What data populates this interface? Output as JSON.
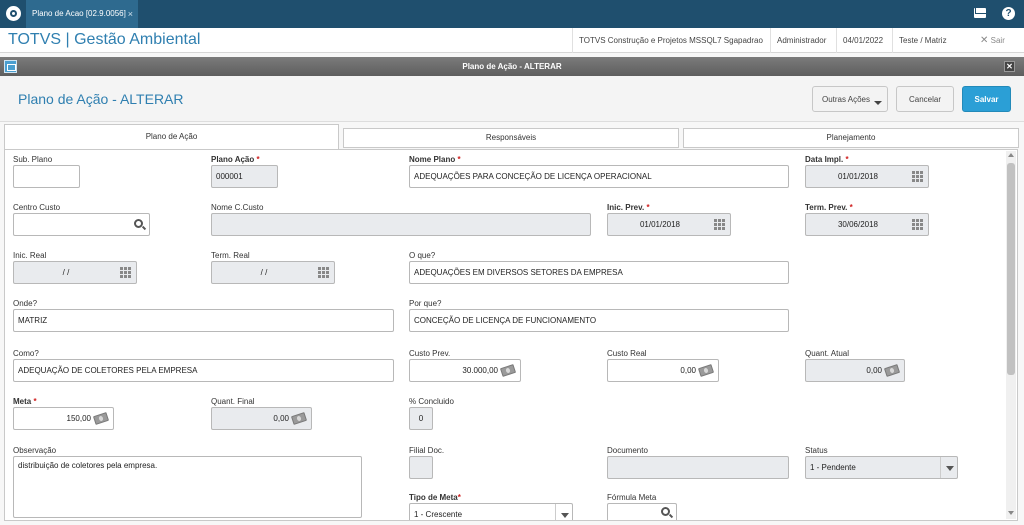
{
  "top": {
    "tab_label": "Plano de Acao [02.9.0056]",
    "tab_close": "×"
  },
  "appbar": {
    "title": "TOTVS | Gestão Ambiental",
    "company": "TOTVS Construção e Projetos MSSQL7 Sgapadrao",
    "user": "Administrador",
    "date": "04/01/2022",
    "branch": "Teste / Matriz",
    "exit": "Sair"
  },
  "dialog": {
    "window_title": "Plano de Ação - ALTERAR",
    "page_title": "Plano de Ação - ALTERAR",
    "other_actions": "Outras Ações",
    "cancel": "Cancelar",
    "save": "Salvar"
  },
  "tabs": [
    "Plano de Ação",
    "Responsáveis",
    "Planejamento"
  ],
  "form": {
    "sub_plano": {
      "label": "Sub. Plano",
      "value": ""
    },
    "plano_acao": {
      "label": "Plano Ação",
      "value": "000001"
    },
    "nome_plano": {
      "label": "Nome Plano",
      "value": "ADEQUAÇÕES PARA CONCEÇÃO DE LICENÇA OPERACIONAL"
    },
    "data_impl": {
      "label": "Data Impl.",
      "value": "01/01/2018"
    },
    "centro_custo": {
      "label": "Centro Custo",
      "value": ""
    },
    "nome_ccusto": {
      "label": "Nome C.Custo",
      "value": ""
    },
    "inic_prev": {
      "label": "Inic. Prev.",
      "value": "01/01/2018"
    },
    "term_prev": {
      "label": "Term. Prev.",
      "value": "30/06/2018"
    },
    "inic_real": {
      "label": "Inic. Real",
      "value": "/ /"
    },
    "term_real": {
      "label": "Term. Real",
      "value": "/ /"
    },
    "o_que": {
      "label": "O que?",
      "value": "ADEQUAÇÕES EM DIVERSOS SETORES DA EMPRESA"
    },
    "onde": {
      "label": "Onde?",
      "value": "MATRIZ"
    },
    "por_que": {
      "label": "Por que?",
      "value": "CONCEÇÃO DE LICENÇA DE FUNCIONAMENTO"
    },
    "como": {
      "label": "Como?",
      "value": "ADEQUAÇÃO DE COLETORES PELA EMPRESA"
    },
    "custo_prev": {
      "label": "Custo Prev.",
      "value": "30.000,00"
    },
    "custo_real": {
      "label": "Custo Real",
      "value": "0,00"
    },
    "quant_atual": {
      "label": "Quant. Atual",
      "value": "0,00"
    },
    "meta": {
      "label": "Meta",
      "value": "150,00"
    },
    "quant_final": {
      "label": "Quant. Final",
      "value": "0,00"
    },
    "pct_concluido": {
      "label": "% Concluido",
      "value": "0"
    },
    "observacao": {
      "label": "Observação",
      "value": "distribuição de coletores pela empresa."
    },
    "filial_doc": {
      "label": "Filial Doc.",
      "value": ""
    },
    "documento": {
      "label": "Documento",
      "value": ""
    },
    "status": {
      "label": "Status",
      "value": "1 - Pendente"
    },
    "tipo_meta": {
      "label": "Tipo de Meta",
      "value": "1 - Crescente"
    },
    "formula_meta": {
      "label": "Fórmula Meta",
      "value": ""
    },
    "required_mark": "*"
  },
  "colors": {
    "topbar": "#1f4f6e",
    "accent": "#2f7fb0",
    "save_button": "#2b9fd6",
    "required": "#d02020"
  },
  "icons": [
    "protheus-logo-icon",
    "mail-icon",
    "help-icon",
    "exit-icon",
    "window-icon",
    "close-icon",
    "calendar-icon",
    "money-icon",
    "search-icon",
    "chevron-down-icon"
  ]
}
